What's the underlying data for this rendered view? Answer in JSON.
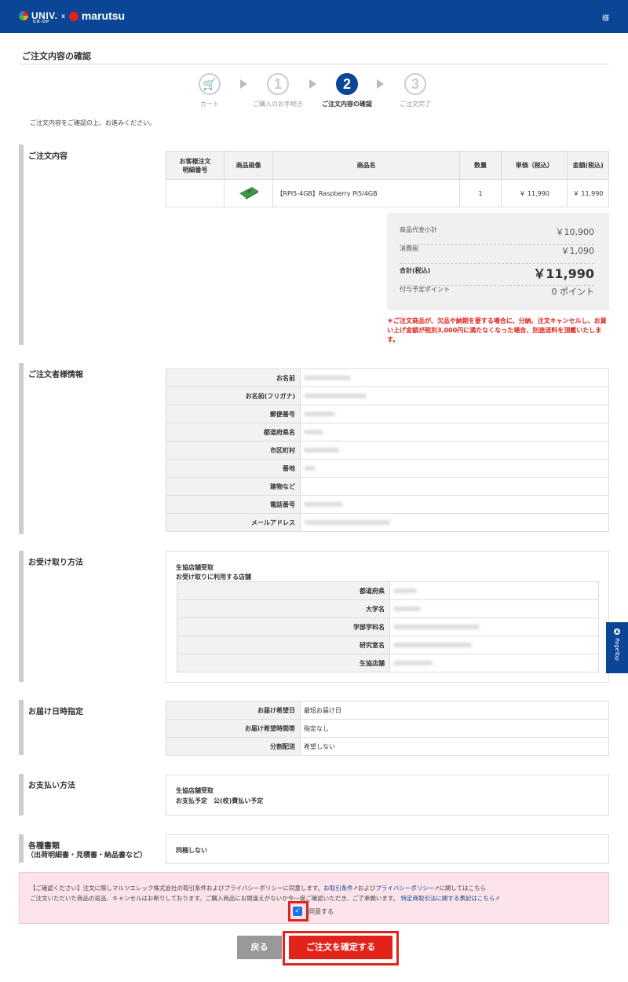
{
  "header": {
    "logo_univ": "UNIV.",
    "logo_coop": "CO-OP",
    "logo_x": "x",
    "logo_marutsu": "marutsu",
    "user": "様"
  },
  "page_title": "ご注文内容の確認",
  "steps": [
    {
      "num": "",
      "label": "カート"
    },
    {
      "num": "1",
      "label": "ご購入のお手続き"
    },
    {
      "num": "2",
      "label": "ご注文内容の確認"
    },
    {
      "num": "3",
      "label": "ご注文完了"
    }
  ],
  "intro": "ご注文内容をご確認の上、お進みください。",
  "order": {
    "title": "ご注文内容",
    "headers": [
      "お客様注文\n明細番号",
      "商品画像",
      "商品名",
      "数量",
      "単価（税込）",
      "金額(税込)"
    ],
    "row": {
      "no": "",
      "name": "【RPI5-4GB】Raspberry Pi5/4GB",
      "qty": "1",
      "price": "￥ 11,990",
      "amount": "￥ 11,990"
    },
    "summary": {
      "subtotal_label": "商品代金小計",
      "subtotal": "￥10,900",
      "tax_label": "消費税",
      "tax": "￥1,090",
      "total_label": "合計(税込)",
      "total": "￥11,990",
      "points_label": "付与予定ポイント",
      "points": "0 ポイント"
    },
    "warning": "＊ご注文商品が、欠品や納期を要する場合に、分納、注文キャンセルし、お買い上げ金額が税別3,000円に満たなくなった場合、別途送料を頂戴いたします。"
  },
  "customer": {
    "title": "ご注文者様情報",
    "rows": [
      "お名前",
      "お名前(フリガナ)",
      "郵便番号",
      "都道府県名",
      "市区町村",
      "番地",
      "建物など",
      "電話番号",
      "メールアドレス"
    ]
  },
  "pickup": {
    "title": "お受け取り方法",
    "line1": "生協店舗受取",
    "line2": "お受け取りに利用する店舗",
    "rows": [
      "都道府県",
      "大学名",
      "学部学科名",
      "研究室名",
      "生協店舗"
    ]
  },
  "delivery": {
    "title": "お届け日時指定",
    "rows": [
      {
        "k": "お届け希望日",
        "v": "最短お届け日"
      },
      {
        "k": "お届け希望時間帯",
        "v": "指定なし"
      },
      {
        "k": "分割配送",
        "v": "希望しない"
      }
    ]
  },
  "payment": {
    "title": "お支払い方法",
    "line1": "生協店舗受取",
    "line2": "お支払予定　公(校)費払い予定"
  },
  "documents": {
    "title": "各種書類",
    "subtitle": "（出荷明細書・見積書・納品書など）",
    "value": "同梱しない"
  },
  "agree": {
    "line1_a": "【ご確認ください】注文に際しマルツエレック株式会社の取引条件およびプライバシーポリシーに同意します。",
    "link1": "お取引条件",
    "line1_b": "および",
    "link2": "プライバシーポリシー",
    "line1_c": "に関してはこちら",
    "line2": "ご注文いただいた商品の返品、キャンセルはお断りしております。ご購入商品にお間違えがないか今一度ご確認いただき、ご了承願います。",
    "link3": "特定商取引法に関する表記はこちら",
    "checkbox_label": "同意する"
  },
  "buttons": {
    "back": "戻る",
    "confirm": "ご注文を確定する"
  },
  "pagetop": "PageTop",
  "colors": {
    "brand": "#0b4595",
    "accent": "#e2231a"
  }
}
